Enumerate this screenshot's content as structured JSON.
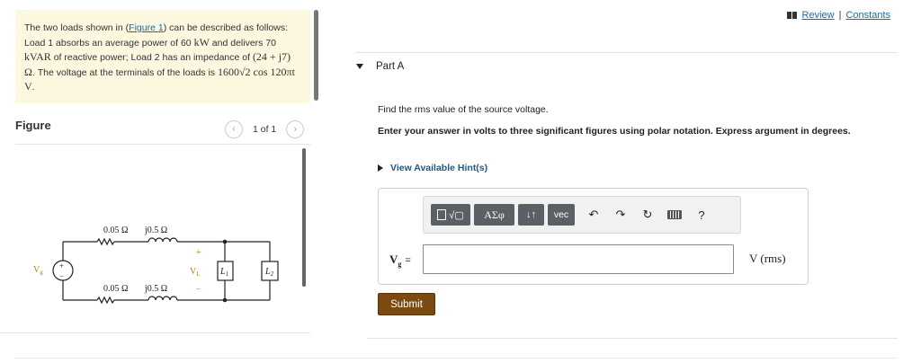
{
  "problem": {
    "text_before_link": "The two loads shown in (",
    "link": "Figure 1",
    "text_after_link": ") can be described as follows: Load 1 absorbs an average power of 60 ",
    "unit_kw": "kW",
    "text_2": " and delivers 70 ",
    "unit_kvar": "kVAR",
    "text_3": " of reactive power; Load 2 has an impedance of ",
    "impedance": "(24 + j7)",
    "unit_ohm": " Ω",
    "text_4": ". The voltage at the terminals of the loads is ",
    "voltage": "1600√2 cos 120πt V",
    "text_5": "."
  },
  "figure": {
    "label": "Figure",
    "pager": "1 of 1",
    "prev": "‹",
    "next": "›",
    "circuit": {
      "top_r": "0.05 Ω",
      "top_x": "j0.5 Ω",
      "bot_r": "0.05 Ω",
      "bot_x": "j0.5 Ω",
      "source": "V",
      "source_sub": "g",
      "vl": "V",
      "vl_sub": "L",
      "plus": "+",
      "minus": "−",
      "src_plus": "+",
      "src_minus": "−",
      "l1": "L",
      "l1_sub": "1",
      "l2": "L",
      "l2_sub": "2"
    }
  },
  "nav": {
    "review": "Review",
    "sep": "|",
    "constants": "Constants"
  },
  "part": {
    "title": "Part A"
  },
  "question": "Find the rms value of the source voltage.",
  "instruction": "Enter your answer in volts to three significant figures using polar notation. Express argument in degrees.",
  "hint": "View Available Hint(s)",
  "toolbar": {
    "sqrt": "√▢",
    "greek": "ΑΣφ",
    "arrows": "↓↑",
    "vec": "vec",
    "undo": "↶",
    "redo": "↷",
    "reset": "↻",
    "help": "?"
  },
  "answer": {
    "var": "V",
    "var_sub": "g",
    "eq": "=",
    "value": "",
    "unit": "V (rms)"
  },
  "submit": "Submit"
}
